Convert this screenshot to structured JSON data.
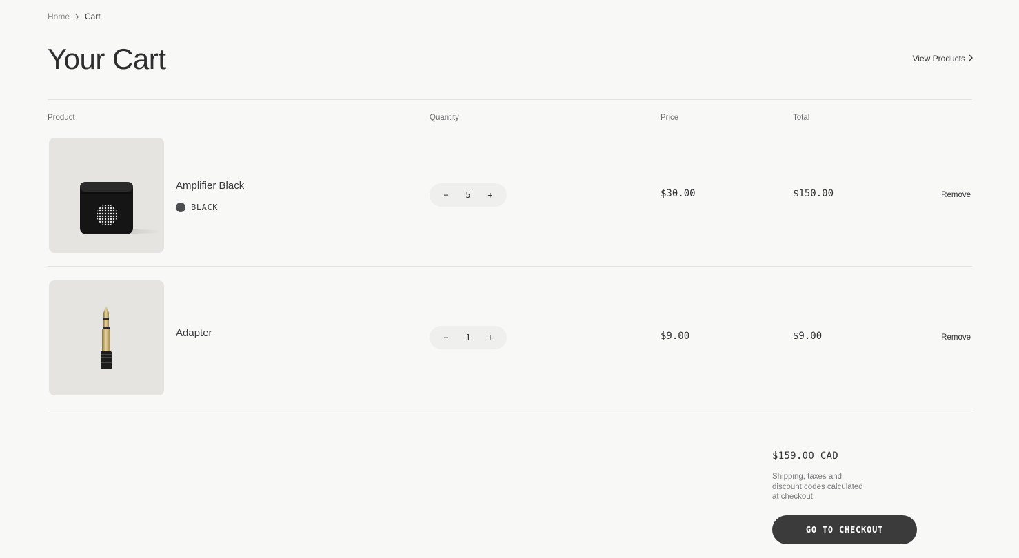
{
  "breadcrumb": {
    "home": "Home",
    "current": "Cart"
  },
  "page": {
    "title": "Your Cart",
    "view_products": "View Products"
  },
  "columns": {
    "product": "Product",
    "quantity": "Quantity",
    "price": "Price",
    "total": "Total"
  },
  "items": [
    {
      "name": "Amplifier Black",
      "variant": "BLACK",
      "variant_color": "#4a4d50",
      "quantity": "5",
      "price": "$30.00",
      "total": "$150.00",
      "remove": "Remove",
      "image_icon": "amplifier-image"
    },
    {
      "name": "Adapter",
      "quantity": "1",
      "price": "$9.00",
      "total": "$9.00",
      "remove": "Remove",
      "image_icon": "adapter-image"
    }
  ],
  "qty_controls": {
    "decrement": "−",
    "increment": "+"
  },
  "summary": {
    "total": "$159.00 CAD",
    "note": "Shipping, taxes and discount codes calculated at checkout.",
    "checkout": "GO TO CHECKOUT"
  },
  "colors": {
    "background": "#f8f8f7",
    "button": "#3b3b3b",
    "thumb": "#e6e4e0"
  }
}
